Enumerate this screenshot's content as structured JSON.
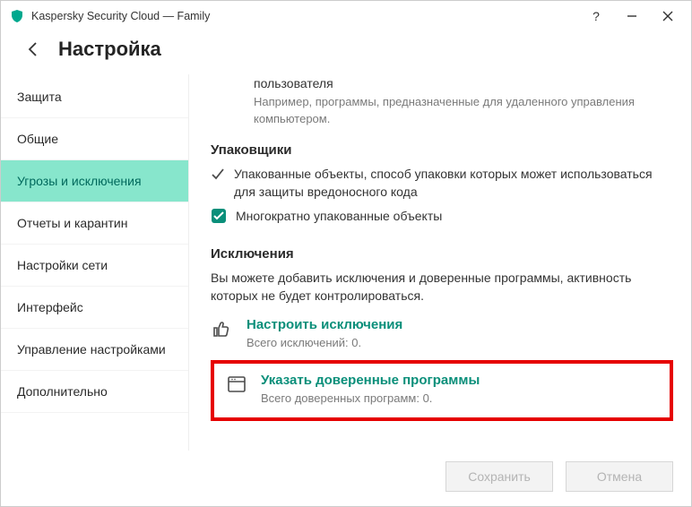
{
  "window": {
    "title": "Kaspersky Security Cloud — Family"
  },
  "header": {
    "page_title": "Настройка"
  },
  "sidebar": {
    "items": [
      {
        "label": "Защита"
      },
      {
        "label": "Общие"
      },
      {
        "label": "Угрозы и исключения"
      },
      {
        "label": "Отчеты и карантин"
      },
      {
        "label": "Настройки сети"
      },
      {
        "label": "Интерфейс"
      },
      {
        "label": "Управление настройками"
      },
      {
        "label": "Дополнительно"
      }
    ],
    "active_index": 2
  },
  "content": {
    "user_block": {
      "heading_tail": "пользователя",
      "desc": "Например, программы, предназначенные для удаленного управления компьютером."
    },
    "packers": {
      "title": "Упаковщики",
      "row1": "Упакованные объекты, способ упаковки которых может использоваться для защиты вредоносного кода",
      "row2": "Многократно упакованные объекты"
    },
    "exclusions": {
      "title": "Исключения",
      "para": "Вы можете добавить исключения и доверенные программы, активность которых не будет контролироваться.",
      "configure": {
        "link": "Настроить исключения",
        "sub": "Всего исключений: 0."
      },
      "trusted": {
        "link": "Указать доверенные программы",
        "sub": "Всего доверенных программ: 0."
      }
    }
  },
  "footer": {
    "save": "Сохранить",
    "cancel": "Отмена"
  }
}
